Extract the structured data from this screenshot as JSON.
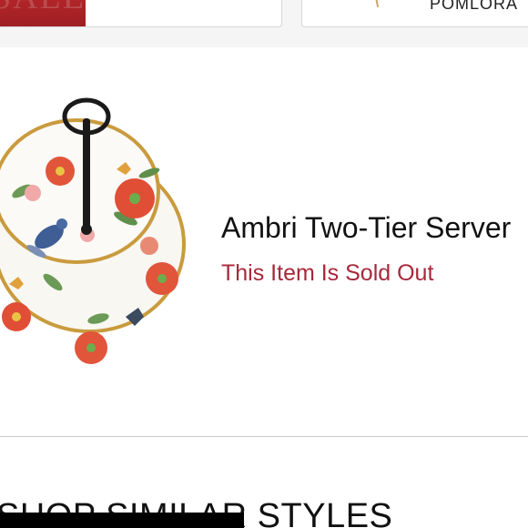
{
  "top_cards": {
    "left_card": {
      "thumbnail_text": "SALE",
      "thumbnail_color": "#b5262a"
    },
    "right_card": {
      "brand_text": "POMLORA",
      "icon": "pin-icon"
    }
  },
  "product": {
    "image_alt": "Ambri Two-Tier Server",
    "title": "Ambri Two-Tier Server",
    "status": "This Item Is Sold Out",
    "status_color": "#a8283a"
  },
  "section": {
    "heading": "SHOP SIMILAR STYLES"
  }
}
